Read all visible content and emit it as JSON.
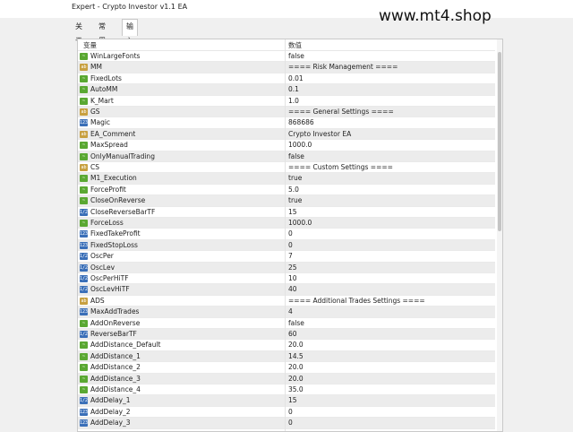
{
  "window": {
    "title": "Expert - Crypto Investor v1.1 EA"
  },
  "watermark": "www.mt4.shop",
  "tabs": [
    {
      "label": "关于"
    },
    {
      "label": "常用"
    },
    {
      "label": "输入参数"
    }
  ],
  "table": {
    "headers": {
      "name": "变量",
      "value": "数值"
    },
    "rows": [
      {
        "icon": "bool",
        "name": "WinLargeFonts",
        "value": "false"
      },
      {
        "icon": "sep",
        "name": "MM",
        "value": "==== Risk Management ===="
      },
      {
        "icon": "bool",
        "name": "FixedLots",
        "value": "0.01"
      },
      {
        "icon": "bool",
        "name": "AutoMM",
        "value": "0.1"
      },
      {
        "icon": "bool",
        "name": "K_Mart",
        "value": "1.0"
      },
      {
        "icon": "sep",
        "name": "GS",
        "value": "==== General Settings ===="
      },
      {
        "icon": "num",
        "name": "Magic",
        "value": "868686"
      },
      {
        "icon": "str",
        "name": "EA_Comment",
        "value": "Crypto Investor EA"
      },
      {
        "icon": "bool",
        "name": "MaxSpread",
        "value": "1000.0"
      },
      {
        "icon": "bool",
        "name": "OnlyManualTrading",
        "value": "false"
      },
      {
        "icon": "sep",
        "name": "CS",
        "value": "==== Custom Settings ===="
      },
      {
        "icon": "bool",
        "name": "M1_Execution",
        "value": "true"
      },
      {
        "icon": "bool",
        "name": "ForceProfit",
        "value": "5.0"
      },
      {
        "icon": "bool",
        "name": "CloseOnReverse",
        "value": "true"
      },
      {
        "icon": "dbl",
        "name": "CloseReverseBarTF",
        "value": "15"
      },
      {
        "icon": "bool",
        "name": "ForceLoss",
        "value": "1000.0"
      },
      {
        "icon": "num",
        "name": "FixedTakeProfit",
        "value": "0"
      },
      {
        "icon": "num",
        "name": "FixedStopLoss",
        "value": "0"
      },
      {
        "icon": "dbl",
        "name": "OscPer",
        "value": "7"
      },
      {
        "icon": "dbl",
        "name": "OscLev",
        "value": "25"
      },
      {
        "icon": "dbl",
        "name": "OscPerHiTF",
        "value": "10"
      },
      {
        "icon": "dbl",
        "name": "OscLevHiTF",
        "value": "40"
      },
      {
        "icon": "sep",
        "name": "ADS",
        "value": "==== Additional Trades Settings ===="
      },
      {
        "icon": "num",
        "name": "MaxAddTrades",
        "value": "4"
      },
      {
        "icon": "bool",
        "name": "AddOnReverse",
        "value": "false"
      },
      {
        "icon": "dbl",
        "name": "ReverseBarTF",
        "value": "60"
      },
      {
        "icon": "bool",
        "name": "AddDistance_Default",
        "value": "20.0"
      },
      {
        "icon": "bool",
        "name": "AddDistance_1",
        "value": "14.5"
      },
      {
        "icon": "bool",
        "name": "AddDistance_2",
        "value": "20.0"
      },
      {
        "icon": "bool",
        "name": "AddDistance_3",
        "value": "20.0"
      },
      {
        "icon": "bool",
        "name": "AddDistance_4",
        "value": "35.0"
      },
      {
        "icon": "dbl",
        "name": "AddDelay_1",
        "value": "15"
      },
      {
        "icon": "num",
        "name": "AddDelay_2",
        "value": "0"
      },
      {
        "icon": "num",
        "name": "AddDelay_3",
        "value": "0"
      }
    ]
  }
}
